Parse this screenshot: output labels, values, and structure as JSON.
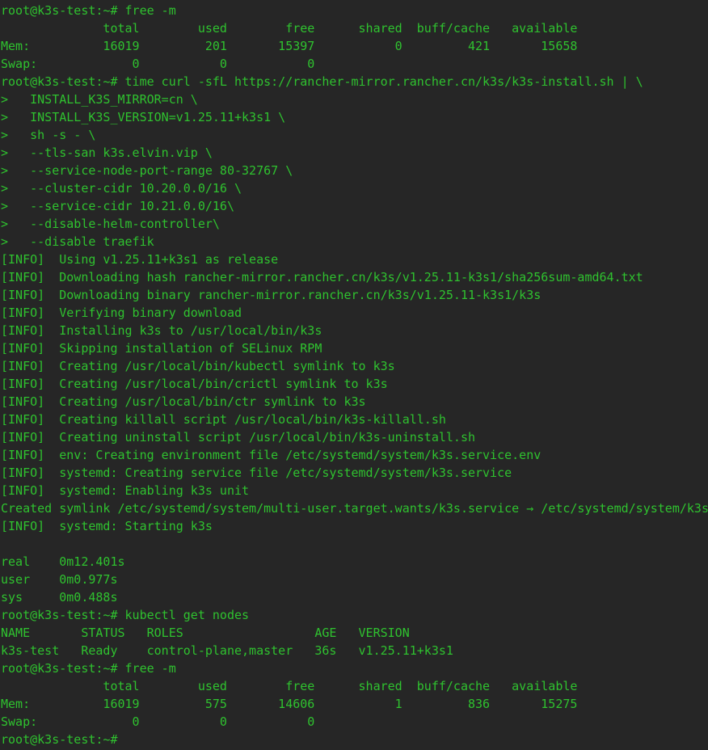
{
  "terminal": {
    "text_color": "#2fc22f",
    "background_color": "#262626",
    "lines": [
      "root@k3s-test:~# free -m",
      "              total        used        free      shared  buff/cache   available",
      "Mem:          16019         201       15397           0         421       15658",
      "Swap:             0           0           0",
      "root@k3s-test:~# time curl -sfL https://rancher-mirror.rancher.cn/k3s/k3s-install.sh | \\",
      ">   INSTALL_K3S_MIRROR=cn \\",
      ">   INSTALL_K3S_VERSION=v1.25.11+k3s1 \\",
      ">   sh -s - \\",
      ">   --tls-san k3s.elvin.vip \\",
      ">   --service-node-port-range 80-32767 \\",
      ">   --cluster-cidr 10.20.0.0/16 \\",
      ">   --service-cidr 10.21.0.0/16\\",
      ">   --disable-helm-controller\\",
      ">   --disable traefik",
      "[INFO]  Using v1.25.11+k3s1 as release",
      "[INFO]  Downloading hash rancher-mirror.rancher.cn/k3s/v1.25.11-k3s1/sha256sum-amd64.txt",
      "[INFO]  Downloading binary rancher-mirror.rancher.cn/k3s/v1.25.11-k3s1/k3s",
      "[INFO]  Verifying binary download",
      "[INFO]  Installing k3s to /usr/local/bin/k3s",
      "[INFO]  Skipping installation of SELinux RPM",
      "[INFO]  Creating /usr/local/bin/kubectl symlink to k3s",
      "[INFO]  Creating /usr/local/bin/crictl symlink to k3s",
      "[INFO]  Creating /usr/local/bin/ctr symlink to k3s",
      "[INFO]  Creating killall script /usr/local/bin/k3s-killall.sh",
      "[INFO]  Creating uninstall script /usr/local/bin/k3s-uninstall.sh",
      "[INFO]  env: Creating environment file /etc/systemd/system/k3s.service.env",
      "[INFO]  systemd: Creating service file /etc/systemd/system/k3s.service",
      "[INFO]  systemd: Enabling k3s unit",
      "Created symlink /etc/systemd/system/multi-user.target.wants/k3s.service → /etc/systemd/system/k3s",
      "[INFO]  systemd: Starting k3s",
      "",
      "real    0m12.401s",
      "user    0m0.977s",
      "sys     0m0.488s",
      "root@k3s-test:~# kubectl get nodes",
      "NAME       STATUS   ROLES                  AGE   VERSION",
      "k3s-test   Ready    control-plane,master   36s   v1.25.11+k3s1",
      "root@k3s-test:~# free -m",
      "              total        used        free      shared  buff/cache   available",
      "Mem:          16019         575       14606           1         836       15275",
      "Swap:             0           0           0",
      "root@k3s-test:~#"
    ]
  }
}
